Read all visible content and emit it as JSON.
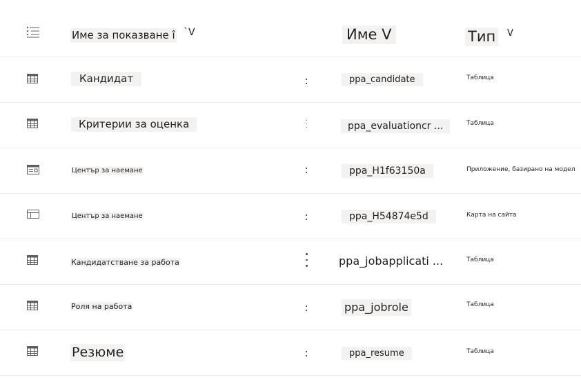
{
  "header": {
    "display_name_label": "Име за показване î",
    "display_name_sort": "`V",
    "name_label": "Име V",
    "type_label": "Тип",
    "type_sort": "V"
  },
  "rows": [
    {
      "display_name": "Кандидат",
      "name": "ppa_candidate",
      "type": "Таблица",
      "icon": "table-icon"
    },
    {
      "display_name": "Критерии за оценка",
      "name": "ppa_evaluationcr ...",
      "type": "Таблица",
      "icon": "table-icon"
    },
    {
      "display_name": "Център за наемане",
      "name": "ppa_H1f63150a",
      "type": "Приложение, базирано на модел",
      "icon": "model-driven-app-icon"
    },
    {
      "display_name": "Център за наемане",
      "name": "ppa_H54874e5d",
      "type": "Карта на сайта",
      "icon": "sitemap-icon"
    },
    {
      "display_name": "Кандидатстване за работа",
      "name": "ppa_jobapplicati ...",
      "type": "Таблица",
      "icon": "table-icon"
    },
    {
      "display_name": "Роля на работа",
      "name": "ppa_jobrole",
      "type": "Таблица",
      "icon": "table-icon"
    },
    {
      "display_name": "Резюме",
      "name": "ppa_resume",
      "type": "Таблица",
      "icon": "table-icon"
    }
  ],
  "colors": {
    "accent": "#742774",
    "border": "#edebe9",
    "chip": "#f3f2f1"
  }
}
